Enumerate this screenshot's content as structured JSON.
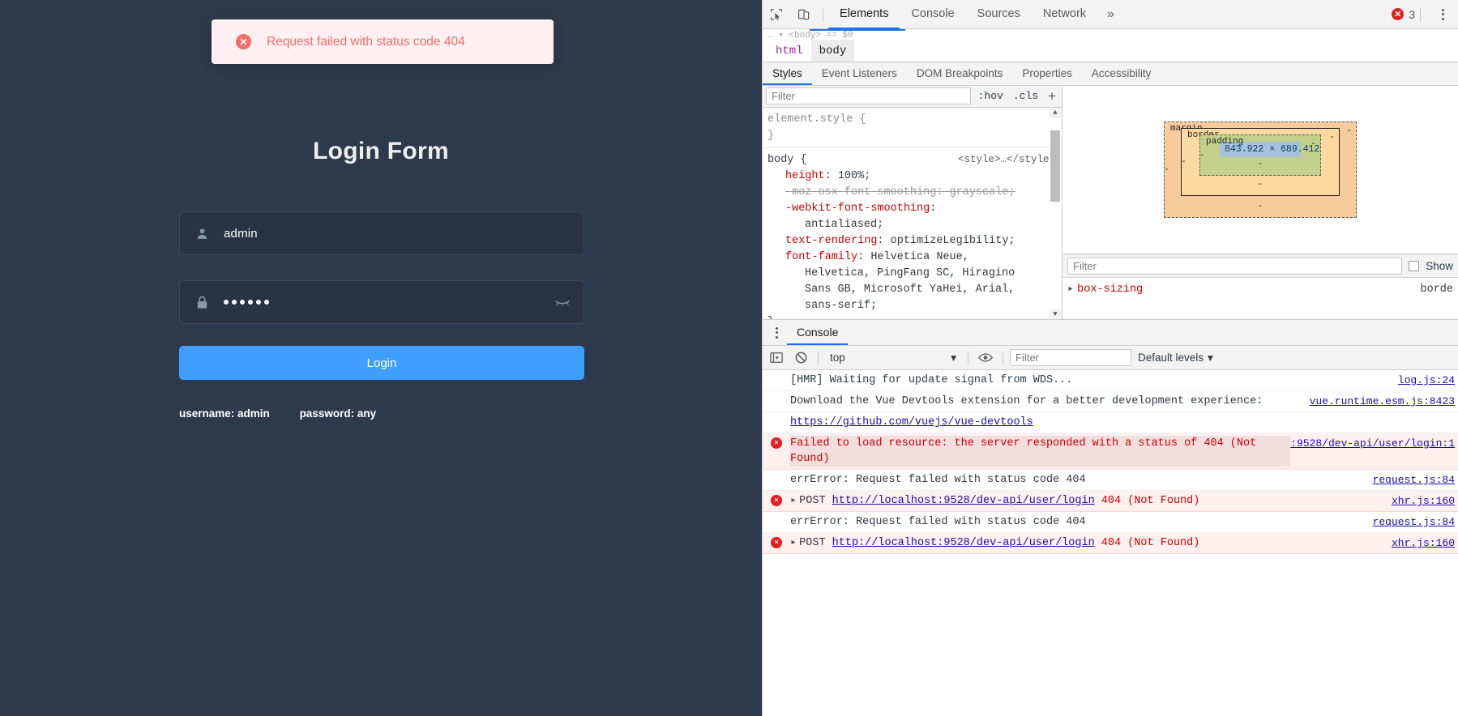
{
  "login_page": {
    "toast": {
      "icon": "error-circle-icon",
      "message": "Request failed with status code 404"
    },
    "title": "Login Form",
    "username_field": {
      "icon": "user-icon",
      "value": "admin",
      "name": "username"
    },
    "password_field": {
      "icon": "lock-icon",
      "masked_value": "••••••",
      "dot_count": 6,
      "eye_icon": "eye-closed-icon"
    },
    "login_button": "Login",
    "tips": {
      "username": "username: admin",
      "password": "password: any"
    },
    "colors": {
      "background": "#2d3a4b",
      "primary": "#409eff",
      "error": "#f56c6c",
      "error_bg": "#fef0f0"
    }
  },
  "devtools": {
    "toolbar": {
      "inspect_icon": "inspect-cursor-icon",
      "device_icon": "device-toolbar-icon",
      "tabs": [
        "Elements",
        "Console",
        "Sources",
        "Network"
      ],
      "active_tab": "Elements",
      "more_tabs": "»",
      "error_count": "3",
      "error_icon": "error-circle-icon",
      "menu_icon": "kebab-menu-icon"
    },
    "dom_strip": "… ▾ <body> == $0",
    "breadcrumb": [
      "html",
      "body"
    ],
    "breadcrumb_current": "body",
    "sub_tabs": [
      "Styles",
      "Event Listeners",
      "DOM Breakpoints",
      "Properties",
      "Accessibility"
    ],
    "sub_tab_active": "Styles",
    "styles_filter_placeholder": "Filter",
    "pseudo_buttons": [
      ":hov",
      ".cls"
    ],
    "add_rule": "+",
    "rules": [
      {
        "selector": "element.style {",
        "source": "",
        "declarations": [],
        "close": "}"
      },
      {
        "selector": "body {",
        "source": "<style>…</style>",
        "declarations": [
          {
            "prop": "height",
            "value": "100%;",
            "struck": false,
            "indent": 1
          },
          {
            "prop": "-moz-osx-font-smoothing",
            "value": "grayscale;",
            "struck": true,
            "indent": 1
          },
          {
            "prop": "-webkit-font-smoothing",
            "value": "",
            "struck": false,
            "indent": 1
          },
          {
            "prop": "",
            "value": "antialiased;",
            "struck": false,
            "indent": 2
          },
          {
            "prop": "text-rendering",
            "value": "optimizeLegibility;",
            "struck": false,
            "indent": 1
          },
          {
            "prop": "font-family",
            "value": "Helvetica Neue,",
            "struck": false,
            "indent": 1
          },
          {
            "prop": "",
            "value": "Helvetica, PingFang SC, Hiragino",
            "struck": false,
            "indent": 2
          },
          {
            "prop": "",
            "value": "Sans GB, Microsoft YaHei, Arial,",
            "struck": false,
            "indent": 2
          },
          {
            "prop": "",
            "value": "sans-serif;",
            "struck": false,
            "indent": 2
          }
        ],
        "close": "}"
      }
    ],
    "box_model": {
      "margin_label": "margin",
      "border_label": "border",
      "padding_label": "padding",
      "content_size": "843.922 × 689.412",
      "dash": "-"
    },
    "computed": {
      "filter_placeholder": "Filter",
      "show_all_label": "Show",
      "properties": [
        {
          "name": "box-sizing",
          "value": "borde"
        }
      ]
    },
    "console": {
      "drawer_tab": "Console",
      "execute_icon": "execution-context-icon",
      "clear_icon": "clear-console-icon",
      "context": "top",
      "eye_icon": "live-expression-icon",
      "filter_placeholder": "Filter",
      "levels": "Default levels",
      "messages": [
        {
          "level": "log",
          "text": "[HMR] Waiting for update signal from WDS...",
          "source": "log.js:24"
        },
        {
          "level": "log",
          "text": "Download the Vue Devtools extension for a better development experience:",
          "source": "vue.runtime.esm.js:8423"
        },
        {
          "level": "log",
          "text": "https://github.com/vuejs/vue-devtools",
          "source": "",
          "is_link": true
        },
        {
          "level": "error",
          "text": "Failed to load resource: the server responded with a status of 404 (Not Found)",
          "source": ":9528/dev-api/user/login:1"
        },
        {
          "level": "log",
          "text": "errError: Request failed with status code 404",
          "source": "request.js:84"
        },
        {
          "level": "error",
          "text": "POST http://localhost:9528/dev-api/user/login 404 (Not Found)",
          "source": "xhr.js:160",
          "has_triangle": true,
          "method": "POST",
          "url": "http://localhost:9528/dev-api/user/login",
          "status": "404 (Not Found)"
        },
        {
          "level": "log",
          "text": "errError: Request failed with status code 404",
          "source": "request.js:84"
        },
        {
          "level": "error",
          "text": "POST http://localhost:9528/dev-api/user/login 404 (Not Found)",
          "source": "xhr.js:160",
          "has_triangle": true,
          "method": "POST",
          "url": "http://localhost:9528/dev-api/user/login",
          "status": "404 (Not Found)"
        }
      ]
    }
  }
}
